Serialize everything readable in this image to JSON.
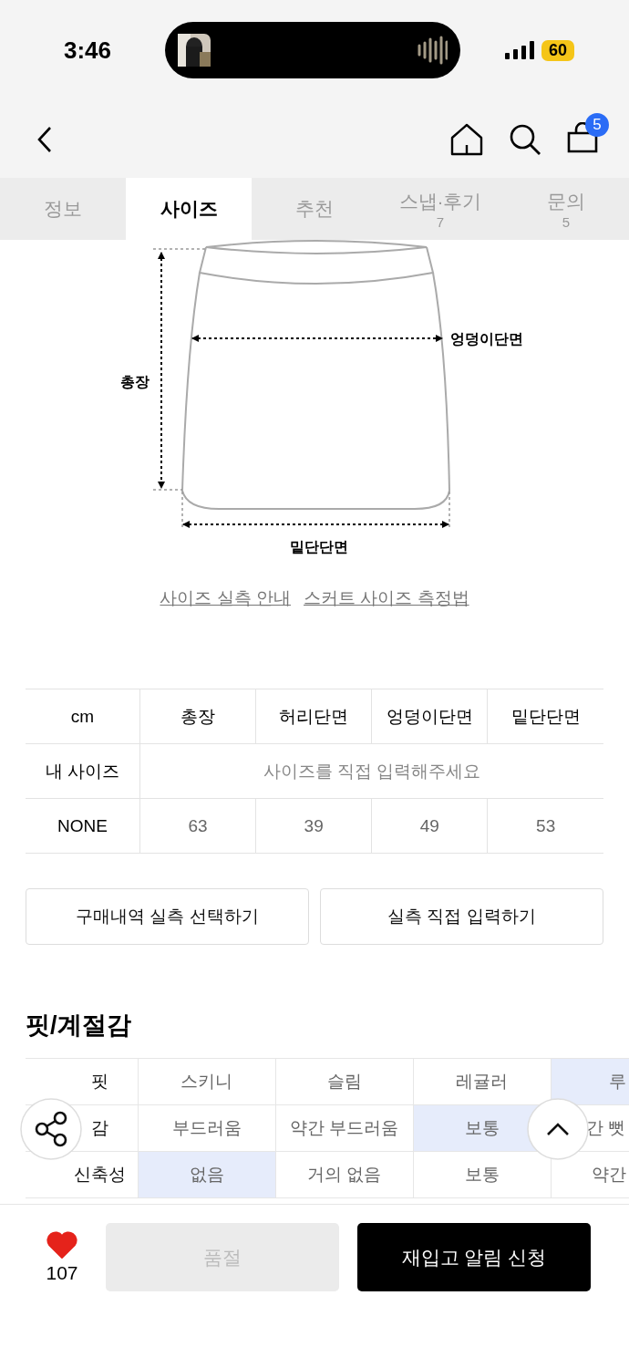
{
  "status_bar": {
    "time": "3:46",
    "battery": "60"
  },
  "nav": {
    "cart_count": "5"
  },
  "tabs": [
    {
      "label": "정보",
      "selected": false
    },
    {
      "label": "사이즈",
      "selected": true
    },
    {
      "label": "추천",
      "selected": false
    },
    {
      "label": "스냅·후기",
      "count": "7",
      "selected": false
    },
    {
      "label": "문의",
      "count": "5",
      "selected": false
    }
  ],
  "diagram": {
    "length_label": "총장",
    "hip_label": "엉덩이단면",
    "hem_label": "밑단단면"
  },
  "links": [
    "사이즈 실측 안내",
    "스커트 사이즈 측정법"
  ],
  "size_table": {
    "columns": [
      "cm",
      "총장",
      "허리단면",
      "엉덩이단면",
      "밑단단면"
    ],
    "rows": [
      {
        "kind": "input",
        "label": "내 사이즈",
        "text": "사이즈를 직접 입력해주세요"
      },
      {
        "kind": "values",
        "label": "NONE",
        "values": [
          "63",
          "39",
          "49",
          "53"
        ]
      }
    ]
  },
  "size_buttons": [
    "구매내역 실측 선택하기",
    "실측 직접 입력하기"
  ],
  "fit": {
    "title": "핏/계절감",
    "rows": [
      {
        "label": "핏",
        "options": [
          {
            "text": "스키니",
            "selected": false
          },
          {
            "text": "슬림",
            "selected": false
          },
          {
            "text": "레귤러",
            "selected": false
          },
          {
            "text": "루",
            "selected": true
          }
        ]
      },
      {
        "label": "감",
        "options": [
          {
            "text": "부드러움",
            "selected": false
          },
          {
            "text": "약간 부드러움",
            "selected": false
          },
          {
            "text": "보통",
            "selected": true
          },
          {
            "text": "간 뻣",
            "selected": false
          }
        ]
      },
      {
        "label": "신축성",
        "options": [
          {
            "text": "없음",
            "selected": true
          },
          {
            "text": "거의 없음",
            "selected": false
          },
          {
            "text": "보통",
            "selected": false
          },
          {
            "text": "약간",
            "selected": false
          }
        ]
      }
    ]
  },
  "bottom_bar": {
    "liked": true,
    "likes": "107",
    "buttons": [
      {
        "label": "품절",
        "disabled": true
      },
      {
        "label": "재입고 알림 신청",
        "disabled": false
      }
    ]
  }
}
